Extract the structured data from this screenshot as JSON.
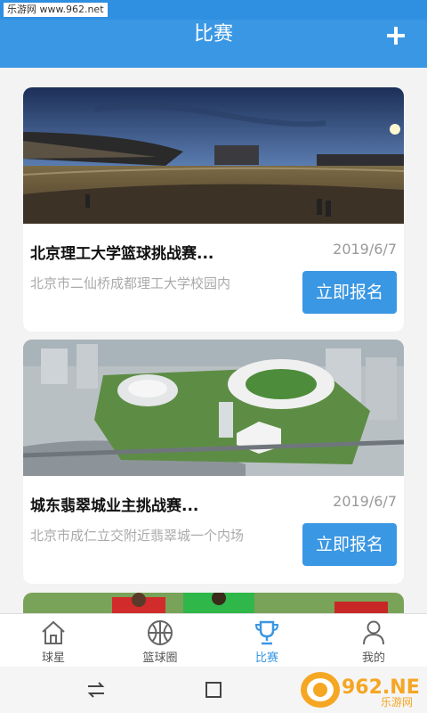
{
  "status": {
    "watermark": "乐游网 www.962.net"
  },
  "header": {
    "title": "比赛",
    "add_icon": "plus-icon"
  },
  "cards": [
    {
      "title": "北京理工大学篮球挑战赛...",
      "date": "2019/6/7",
      "location": "北京市二仙桥成都理工大学校园内",
      "button": "立即报名",
      "image": "stadium-night-photo"
    },
    {
      "title": "城东翡翠城业主挑战赛...",
      "date": "2019/6/7",
      "location": "北京市成仁立交附近翡翠城一个内场",
      "button": "立即报名",
      "image": "stadium-aerial-photo"
    }
  ],
  "tabs": [
    {
      "label": "球星",
      "icon": "home-icon",
      "active": false
    },
    {
      "label": "篮球圈",
      "icon": "basketball-icon",
      "active": false
    },
    {
      "label": "比赛",
      "icon": "trophy-icon",
      "active": true
    },
    {
      "label": "我的",
      "icon": "user-icon",
      "active": false
    }
  ],
  "watermark_logo": {
    "text": "962.NET",
    "subtext": "乐游网"
  },
  "colors": {
    "primary": "#3a97e3",
    "text": "#111111",
    "muted": "#999999"
  }
}
